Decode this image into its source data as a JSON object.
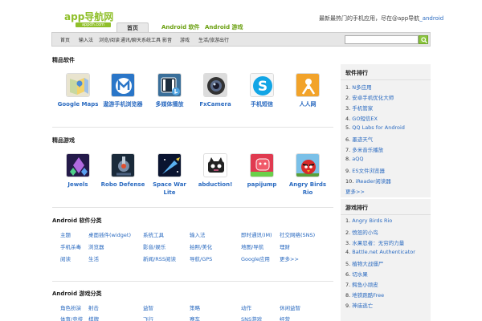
{
  "header": {
    "logo_text": "app导航网",
    "logo_sub": "appdh.com",
    "tabs": [
      {
        "label": "首页",
        "active": true
      },
      {
        "label": "Android 软件",
        "active": false
      },
      {
        "label": "Android 游戏",
        "active": false
      }
    ],
    "promo_prefix": "最新最热门的手机应用，尽在@app导航",
    "promo_link": "_android"
  },
  "nav": {
    "items": [
      "首页",
      "输入法",
      "浏览/阅读",
      "通讯/聊天",
      "系统工具",
      "影音",
      "游戏",
      "生活/旅游出行"
    ],
    "search_placeholder": ""
  },
  "featured_software": {
    "title": "精品软件",
    "apps": [
      {
        "name": "Google Maps",
        "icon": "google-maps-icon"
      },
      {
        "name": "遨游手机浏览器",
        "icon": "maxthon-icon"
      },
      {
        "name": "多媒体播放",
        "icon": "media-player-icon"
      },
      {
        "name": "FxCamera",
        "icon": "camera-icon"
      },
      {
        "name": "手机短信",
        "icon": "skype-icon"
      },
      {
        "name": "人人网",
        "icon": "renren-icon"
      }
    ]
  },
  "featured_games": {
    "title": "精品游戏",
    "apps": [
      {
        "name": "Jewels",
        "icon": "jewels-icon"
      },
      {
        "name": "Robo Defense",
        "icon": "robo-defense-icon"
      },
      {
        "name": "Space War Lite",
        "icon": "space-war-icon"
      },
      {
        "name": "abduction!",
        "icon": "abduction-icon"
      },
      {
        "name": "papijump",
        "icon": "papijump-icon"
      },
      {
        "name": "Angry Birds Rio",
        "icon": "angry-birds-icon"
      }
    ]
  },
  "software_categories": {
    "title": "Android 软件分类",
    "rows": [
      [
        "主题",
        "桌面插件(widget)",
        "系统工具",
        "输入法",
        "即时通讯(IM)",
        "社交网络(SNS)"
      ],
      [
        "手机杀毒",
        "浏览器",
        "影音/娱乐",
        "拍照/美化",
        "地图/导航",
        "理财"
      ],
      [
        "阅读",
        "生活",
        "新闻/RSS阅读",
        "导航/GPS",
        "Google应用",
        "更多>>"
      ]
    ]
  },
  "game_categories": {
    "title": "Android 游戏分类",
    "rows": [
      [
        "角色扮演",
        "射击",
        "益智",
        "策略",
        "动作",
        "休闲益智"
      ],
      [
        "体育/竞技",
        "棋牌",
        "飞行",
        "赛车",
        "SNS游戏",
        "经营"
      ]
    ]
  },
  "sidebar": {
    "software_ranking": {
      "title": "软件排行",
      "items": [
        "N多应用",
        "安卓手机优化大师",
        "手机管家",
        "GO短信EX",
        "QQ Labs for Android",
        "墨迹天气",
        "多米音乐播放",
        "aQQ",
        "ES文件浏览器",
        "iReader阅读器"
      ],
      "more": "更多>>"
    },
    "game_ranking": {
      "title": "游戏排行",
      "items": [
        "Angry Birds Rio",
        "愤怒的小鸟",
        "水果忍者：无穷的力量",
        "Battle.net Authenticator",
        "植物大战僵尸",
        "切水果",
        "鳄鱼小顽皮",
        "地铁跑酷Free",
        "神庙逃亡"
      ]
    }
  },
  "colors": {
    "brand_green": "#8fbf2a",
    "link_blue": "#2a6ac0",
    "nav_bg": "#e6e6e6",
    "sidebar_bg": "#f2f2f2"
  }
}
